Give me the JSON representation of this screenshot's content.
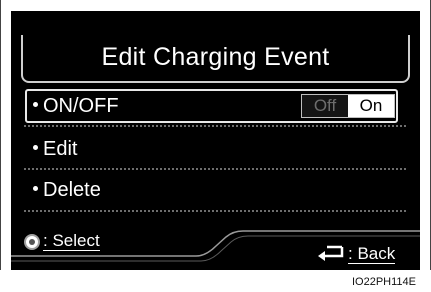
{
  "header": {
    "title": "Edit Charging Event"
  },
  "menu": {
    "items": [
      {
        "label": "ON/OFF"
      },
      {
        "label": "Edit"
      },
      {
        "label": "Delete"
      }
    ],
    "toggle": {
      "off_label": "Off",
      "on_label": "On",
      "state": "On"
    }
  },
  "footer": {
    "select_label": ": Select",
    "back_label": ": Back"
  },
  "caption": "IO22PH114E"
}
